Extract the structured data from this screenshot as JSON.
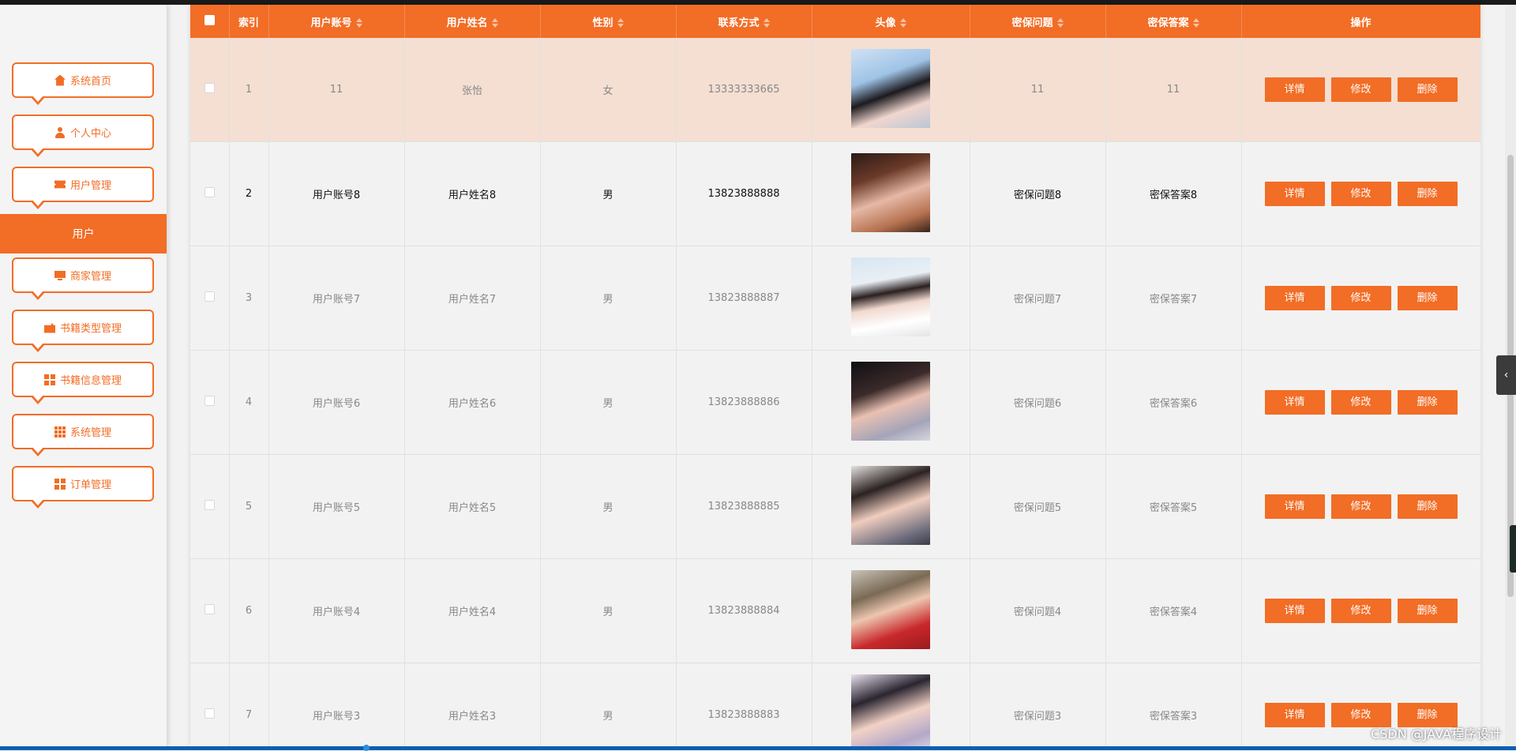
{
  "sidebar": {
    "items": [
      {
        "label": "系统首页",
        "icon": "home-icon"
      },
      {
        "label": "个人中心",
        "icon": "user-icon"
      },
      {
        "label": "用户管理",
        "icon": "ticket-icon"
      },
      {
        "label": "商家管理",
        "icon": "monitor-icon"
      },
      {
        "label": "书籍类型管理",
        "icon": "wallet-icon"
      },
      {
        "label": "书籍信息管理",
        "icon": "grid-icon"
      },
      {
        "label": "系统管理",
        "icon": "grid9-icon"
      },
      {
        "label": "订单管理",
        "icon": "grid-icon"
      }
    ],
    "active_sub": "用户"
  },
  "table": {
    "headers": {
      "index": "索引",
      "account": "用户账号",
      "name": "用户姓名",
      "gender": "性别",
      "phone": "联系方式",
      "avatar": "头像",
      "question": "密保问题",
      "answer": "密保答案",
      "actions": "操作"
    },
    "rows": [
      {
        "index": "1",
        "account": "11",
        "name": "张怡",
        "gender": "女",
        "phone": "13333333665",
        "question": "11",
        "answer": "11"
      },
      {
        "index": "2",
        "account": "用户账号8",
        "name": "用户姓名8",
        "gender": "男",
        "phone": "13823888888",
        "question": "密保问题8",
        "answer": "密保答案8"
      },
      {
        "index": "3",
        "account": "用户账号7",
        "name": "用户姓名7",
        "gender": "男",
        "phone": "13823888887",
        "question": "密保问题7",
        "answer": "密保答案7"
      },
      {
        "index": "4",
        "account": "用户账号6",
        "name": "用户姓名6",
        "gender": "男",
        "phone": "13823888886",
        "question": "密保问题6",
        "answer": "密保答案6"
      },
      {
        "index": "5",
        "account": "用户账号5",
        "name": "用户姓名5",
        "gender": "男",
        "phone": "13823888885",
        "question": "密保问题5",
        "answer": "密保答案5"
      },
      {
        "index": "6",
        "account": "用户账号4",
        "name": "用户姓名4",
        "gender": "男",
        "phone": "13823888884",
        "question": "密保问题4",
        "answer": "密保答案4"
      },
      {
        "index": "7",
        "account": "用户账号3",
        "name": "用户姓名3",
        "gender": "男",
        "phone": "13823888883",
        "question": "密保问题3",
        "answer": "密保答案3"
      }
    ],
    "actions": {
      "detail": "详情",
      "edit": "修改",
      "delete": "删除"
    }
  },
  "side_tab": "‹",
  "watermark": "CSDN @JAVA程序设计",
  "colors": {
    "accent": "#f26d26",
    "highlight_row": "#f4dfd2"
  }
}
